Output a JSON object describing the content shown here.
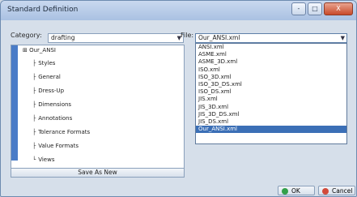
{
  "window": {
    "title": "Standard Definition",
    "controls": [
      "-",
      "□",
      "X"
    ]
  },
  "category": {
    "label": "Category:",
    "value": "drafting"
  },
  "file": {
    "label": "File:",
    "value": "Our_ANSI.xml",
    "options": [
      "ANSI.xml",
      "ASME.xml",
      "ASME_3D.xml",
      "ISO.xml",
      "ISO_3D.xml",
      "ISO_3D_DS.xml",
      "ISO_DS.xml",
      "JIS.xml",
      "JIS_3D.xml",
      "JIS_3D_DS.xml",
      "JIS_DS.xml",
      "Our_ANSI.xml"
    ]
  },
  "tree": {
    "root": "Our_ANSI",
    "items": [
      "Styles",
      "General",
      "Dress-Up",
      "Dimensions",
      "Annotations",
      "Tolerance Formats",
      "Value Formats",
      "Views"
    ]
  },
  "buttons": {
    "save_as_new": "Save As New",
    "ok": "OK",
    "cancel": "Cancel"
  },
  "colors": {
    "selected": "#3b6fb6",
    "ok_dot": "#33a04a",
    "cancel_dot": "#d24a3a"
  }
}
